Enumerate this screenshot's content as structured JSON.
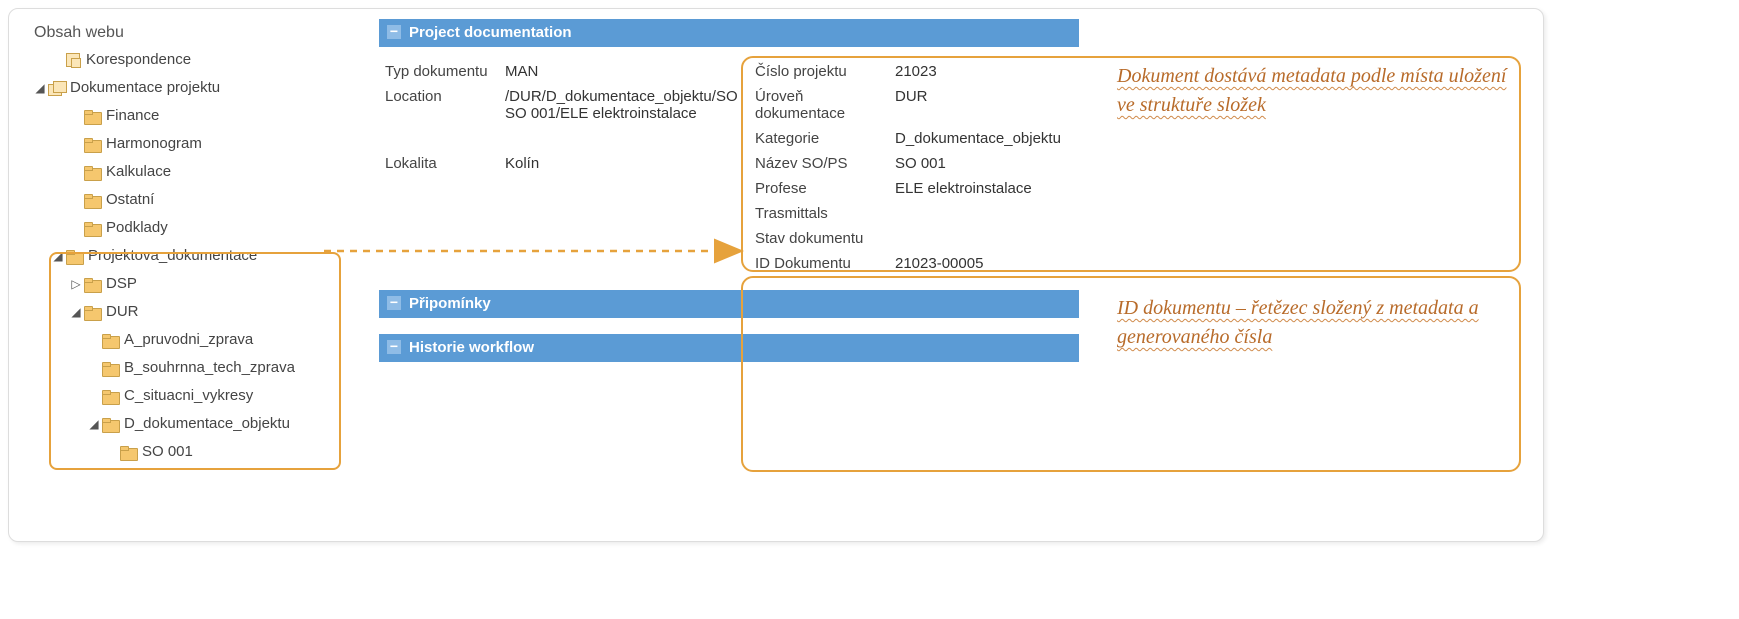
{
  "tree": {
    "title": "Obsah webu",
    "root": [
      {
        "label": "Korespondence",
        "icon": "doc"
      },
      {
        "label": "Dokumentace projektu",
        "icon": "link",
        "expanded": true,
        "children": [
          {
            "label": "Finance",
            "icon": "folder"
          },
          {
            "label": "Harmonogram",
            "icon": "folder"
          },
          {
            "label": "Kalkulace",
            "icon": "folder"
          },
          {
            "label": "Ostatní",
            "icon": "folder"
          },
          {
            "label": "Podklady",
            "icon": "folder"
          },
          {
            "label": "Projektova_dokumentace",
            "icon": "folder",
            "expanded": true,
            "children": [
              {
                "label": "DSP",
                "icon": "folder",
                "hasChildren": true,
                "expanded": false
              },
              {
                "label": "DUR",
                "icon": "folder",
                "expanded": true,
                "children": [
                  {
                    "label": "A_pruvodni_zprava",
                    "icon": "folder"
                  },
                  {
                    "label": "B_souhrnna_tech_zprava",
                    "icon": "folder"
                  },
                  {
                    "label": "C_situacni_vykresy",
                    "icon": "folder"
                  },
                  {
                    "label": "D_dokumentace_objektu",
                    "icon": "folder",
                    "expanded": true,
                    "children": [
                      {
                        "label": "SO 001",
                        "icon": "folder"
                      }
                    ]
                  }
                ]
              }
            ]
          }
        ]
      }
    ]
  },
  "panels": {
    "doc": {
      "title": "Project documentation"
    },
    "rem": {
      "title": "Připomínky"
    },
    "wf": {
      "title": "Historie workflow"
    }
  },
  "fields": {
    "typLabel": "Typ dokumentu",
    "typ": "MAN",
    "locLabel": "Location",
    "loc": "/DUR/D_dokumentace_objektu/SO SO 001/ELE elektroinstalace",
    "lokLabel": "Lokalita",
    "lok": "Kolín",
    "cisloLabel": "Číslo projektu",
    "cislo": "21023",
    "urovenLabel": "Úroveň dokumentace",
    "uroven": "DUR",
    "katLabel": "Kategorie",
    "kat": "D_dokumentace_objektu",
    "nazevLabel": "Název SO/PS",
    "nazev": "SO 001",
    "profLabel": "Profese",
    "prof": "ELE elektroinstalace",
    "trasLabel": "Trasmittals",
    "tras": "",
    "stavLabel": "Stav dokumentu",
    "stav": "",
    "idLabel": "ID Dokumentu",
    "id": "21023-00005"
  },
  "callouts": {
    "c1": "Dokument dostává metadata podle místa uložení ve struktuře složek",
    "c2": "ID dokumentu – řetězec složený z metadata a generovaného čísla"
  }
}
